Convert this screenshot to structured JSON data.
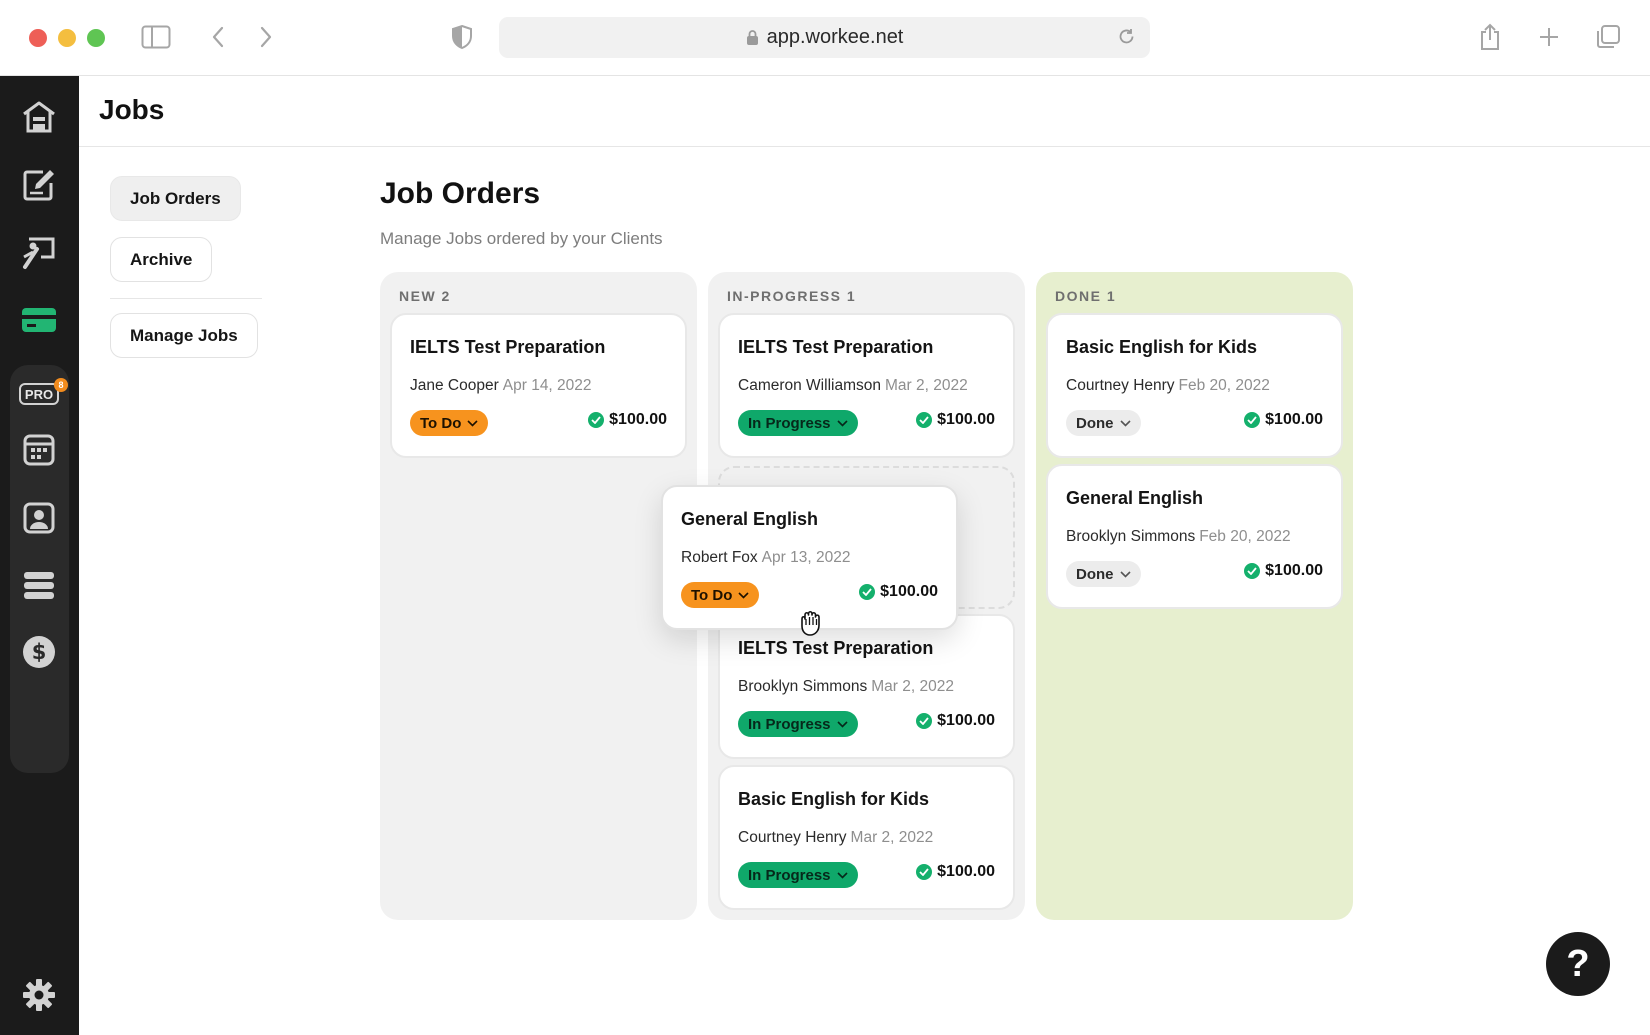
{
  "browser": {
    "url": "app.workee.net"
  },
  "sidebar": {
    "icons": [
      "home-icon",
      "edit-icon",
      "presentation-icon",
      "credit-card-icon",
      "pro-icon",
      "calendar-icon",
      "contact-icon",
      "layers-icon",
      "dollar-icon",
      "settings-icon"
    ],
    "pro_label": "PRO",
    "pro_badge_count": "8",
    "active_color": "#22b573"
  },
  "header": {
    "title": "Jobs"
  },
  "subnav": {
    "job_orders": "Job Orders",
    "archive": "Archive",
    "manage_jobs": "Manage Jobs"
  },
  "main": {
    "title": "Job Orders",
    "subtitle": "Manage Jobs ordered by your Clients"
  },
  "columns": {
    "new": {
      "header": "NEW 2",
      "cards": [
        {
          "title": "IELTS Test Preparation",
          "person": "Jane Cooper",
          "date": "Apr 14, 2022",
          "status": "To Do",
          "price": "$100.00"
        }
      ]
    },
    "in_progress": {
      "header": "IN-PROGRESS 1",
      "cards": [
        {
          "title": "IELTS Test Preparation",
          "person": "Cameron Williamson",
          "date": "Mar 2, 2022",
          "status": "In Progress",
          "price": "$100.00"
        },
        {
          "title": "IELTS Test Preparation",
          "person": "Brooklyn Simmons",
          "date": "Mar 2, 2022",
          "status": "In Progress",
          "price": "$100.00"
        },
        {
          "title": "Basic English for Kids",
          "person": "Courtney Henry",
          "date": "Mar 2, 2022",
          "status": "In Progress",
          "price": "$100.00"
        }
      ]
    },
    "done": {
      "header": "DONE 1",
      "cards": [
        {
          "title": "Basic English for Kids",
          "person": "Courtney Henry",
          "date": "Feb 20, 2022",
          "status": "Done",
          "price": "$100.00"
        },
        {
          "title": "General English",
          "person": "Brooklyn Simmons",
          "date": "Feb 20, 2022",
          "status": "Done",
          "price": "$100.00"
        }
      ]
    }
  },
  "dragging_card": {
    "title": "General English",
    "person": "Robert Fox",
    "date": "Apr 13, 2022",
    "status": "To Do",
    "price": "$100.00"
  },
  "help": {
    "label": "?"
  },
  "colors": {
    "todo": "#f7931e",
    "in_progress": "#0fa86a",
    "done_column": "#e7efcf",
    "check": "#14b06c"
  }
}
